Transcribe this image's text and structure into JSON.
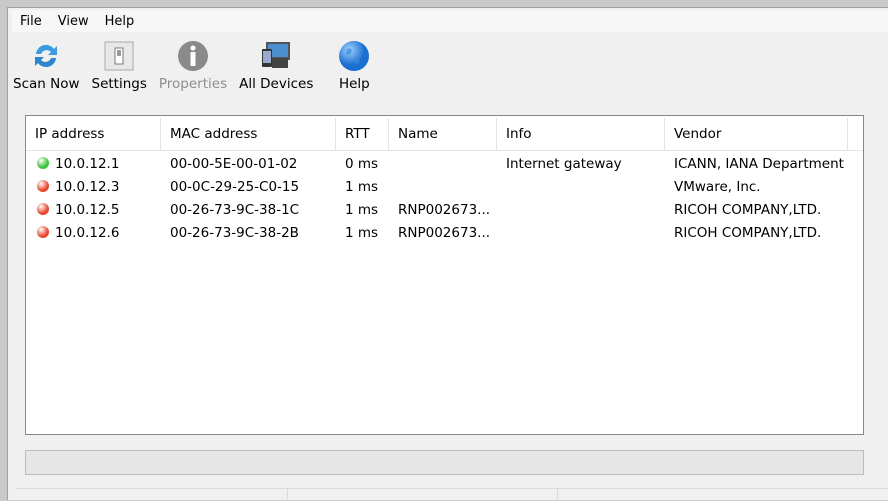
{
  "menu": [
    "File",
    "View",
    "Help"
  ],
  "toolbar": [
    {
      "label": "Scan Now",
      "icon": "refresh-icon",
      "enabled": true
    },
    {
      "label": "Settings",
      "icon": "switch-icon",
      "enabled": true
    },
    {
      "label": "Properties",
      "icon": "info-icon",
      "enabled": false
    },
    {
      "label": "All Devices",
      "icon": "devices-icon",
      "enabled": true
    },
    {
      "label": "Help",
      "icon": "globe-icon",
      "enabled": true
    }
  ],
  "columns": [
    "IP address",
    "MAC address",
    "RTT",
    "Name",
    "Info",
    "Vendor"
  ],
  "rows": [
    {
      "status": "online",
      "color": "#3cc23a",
      "ip": "10.0.12.1",
      "mac": "00-00-5E-00-01-02",
      "rtt": "0 ms",
      "name": "",
      "info": "Internet gateway",
      "vendor": "ICANN, IANA Department"
    },
    {
      "status": "offline",
      "color": "#e8452a",
      "ip": "10.0.12.3",
      "mac": "00-0C-29-25-C0-15",
      "rtt": "1 ms",
      "name": "",
      "info": "",
      "vendor": "VMware, Inc."
    },
    {
      "status": "offline",
      "color": "#e8452a",
      "ip": "10.0.12.5",
      "mac": "00-26-73-9C-38-1C",
      "rtt": "1 ms",
      "name": "RNP002673...",
      "info": "",
      "vendor": "RICOH COMPANY,LTD."
    },
    {
      "status": "offline",
      "color": "#e8452a",
      "ip": "10.0.12.6",
      "mac": "00-26-73-9C-38-2B",
      "rtt": "1 ms",
      "name": "RNP002673...",
      "info": "",
      "vendor": "RICOH COMPANY,LTD."
    }
  ]
}
